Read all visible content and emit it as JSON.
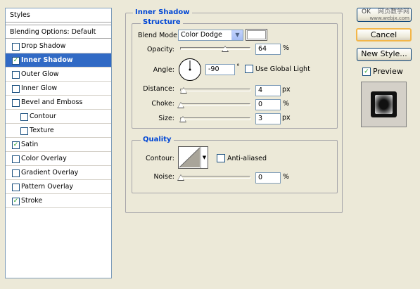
{
  "styles_list": {
    "header": "Styles",
    "blending_options": "Blending Options: Default",
    "items": [
      {
        "label": "Drop Shadow",
        "checked": false
      },
      {
        "label": "Inner Shadow",
        "checked": true,
        "selected": true
      },
      {
        "label": "Outer Glow",
        "checked": false
      },
      {
        "label": "Inner Glow",
        "checked": false
      },
      {
        "label": "Bevel and Emboss",
        "checked": false
      },
      {
        "label": "Contour",
        "checked": false
      },
      {
        "label": "Texture",
        "checked": false
      },
      {
        "label": "Satin",
        "checked": true
      },
      {
        "label": "Color Overlay",
        "checked": false
      },
      {
        "label": "Gradient Overlay",
        "checked": false
      },
      {
        "label": "Pattern Overlay",
        "checked": false
      },
      {
        "label": "Stroke",
        "checked": true
      }
    ]
  },
  "inner_shadow": {
    "title": "Inner Shadow",
    "structure": {
      "title": "Structure",
      "blend_mode_label": "Blend Mode:",
      "blend_mode_value": "Color Dodge",
      "opacity_label": "Opacity:",
      "opacity_value": "64",
      "opacity_unit": "%",
      "opacity_fraction": 0.64,
      "angle_label": "Angle:",
      "angle_value": "-90",
      "angle_unit": "°",
      "use_global_light_label": "Use Global Light",
      "use_global_light_checked": false,
      "distance_label": "Distance:",
      "distance_value": "4",
      "distance_unit": "px",
      "choke_label": "Choke:",
      "choke_value": "0",
      "choke_unit": "%",
      "size_label": "Size:",
      "size_value": "3",
      "size_unit": "px"
    },
    "quality": {
      "title": "Quality",
      "contour_label": "Contour:",
      "anti_aliased_label": "Anti-aliased",
      "anti_aliased_checked": false,
      "noise_label": "Noise:",
      "noise_value": "0",
      "noise_unit": "%"
    }
  },
  "buttons": {
    "ok_label": "OK",
    "cancel_label": "Cancel",
    "new_style_label": "New Style...",
    "preview_label": "Preview",
    "preview_checked": true
  },
  "watermark": {
    "line1": "网页教学网",
    "line2": "www.webjx.com"
  },
  "colors": {
    "dialog_bg": "#ece9d8",
    "selection": "#316ac5",
    "group_title": "#0046d5",
    "shadow_color": "#ffffff"
  }
}
